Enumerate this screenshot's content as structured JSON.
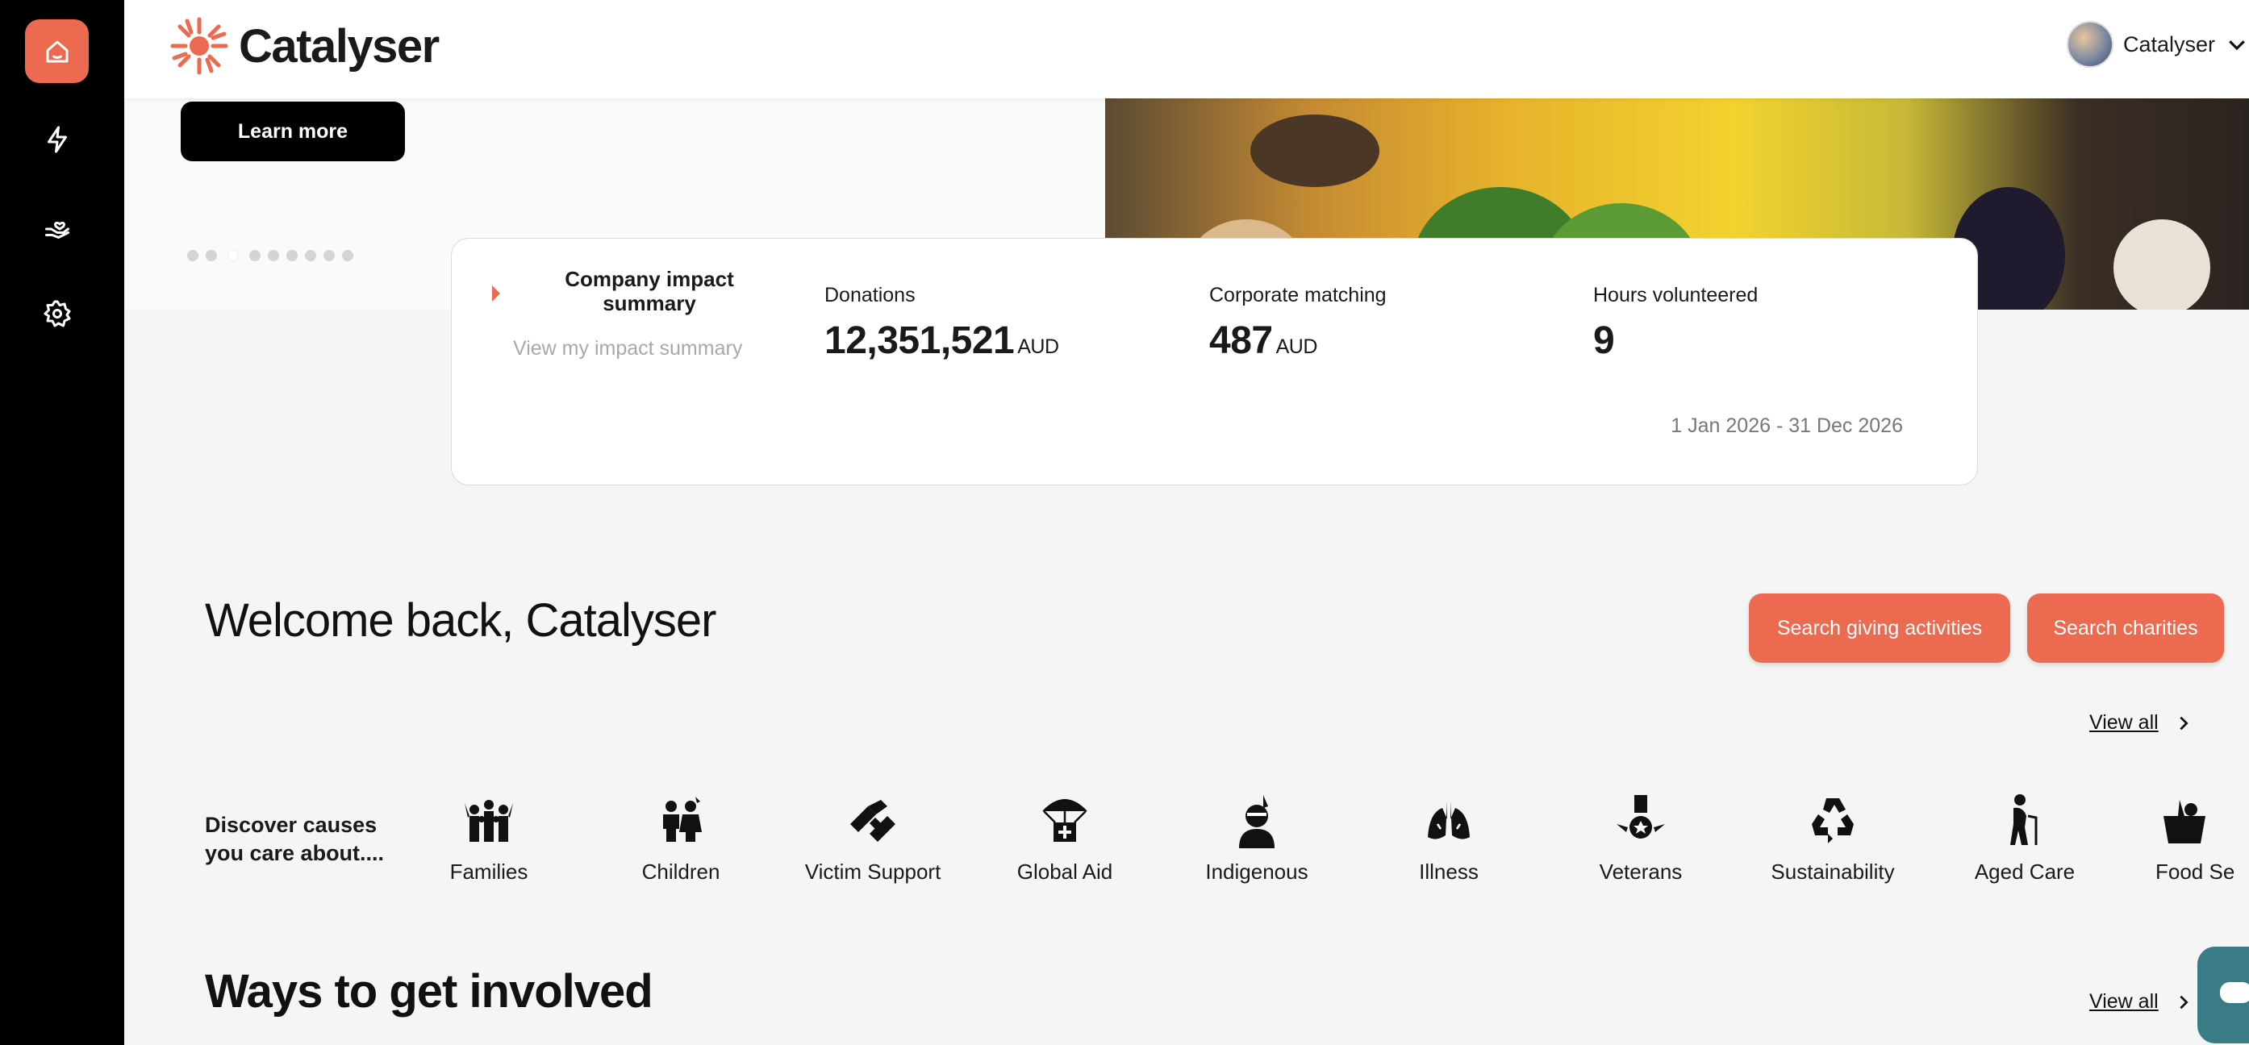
{
  "sidebar": {
    "items": [
      {
        "icon": "home-icon",
        "active": true
      },
      {
        "icon": "lightning-icon",
        "active": false
      },
      {
        "icon": "hand-heart-icon",
        "active": false
      },
      {
        "icon": "gear-icon",
        "active": false
      }
    ]
  },
  "header": {
    "brand": "Catalyser",
    "user_name": "Catalyser"
  },
  "hero": {
    "learn_more": "Learn more"
  },
  "impact": {
    "title": "Company impact summary",
    "link": "View my impact summary",
    "stats": [
      {
        "label": "Donations",
        "value": "12,351,521",
        "unit": "AUD"
      },
      {
        "label": "Corporate matching",
        "value": "487",
        "unit": "AUD"
      },
      {
        "label": "Hours volunteered",
        "value": "9",
        "unit": ""
      }
    ],
    "date_range": "1 Jan 2026 - 31 Dec 2026"
  },
  "welcome": {
    "title": "Welcome back, Catalyser",
    "search_activities": "Search giving activities",
    "search_charities": "Search charities",
    "view_all": "View all"
  },
  "causes": {
    "label": "Discover causes you care about....",
    "items": [
      {
        "label": "Families",
        "icon": "families-icon"
      },
      {
        "label": "Children",
        "icon": "children-icon"
      },
      {
        "label": "Victim Support",
        "icon": "victim-support-icon"
      },
      {
        "label": "Global Aid",
        "icon": "global-aid-icon"
      },
      {
        "label": "Indigenous",
        "icon": "indigenous-icon"
      },
      {
        "label": "Illness",
        "icon": "lungs-icon"
      },
      {
        "label": "Veterans",
        "icon": "medal-icon"
      },
      {
        "label": "Sustainability",
        "icon": "recycle-icon"
      },
      {
        "label": "Aged Care",
        "icon": "aged-care-icon"
      },
      {
        "label": "Food Se",
        "icon": "food-security-icon"
      }
    ]
  },
  "involved": {
    "title": "Ways to get involved",
    "view_all": "View all"
  },
  "colors": {
    "accent": "#ec6a50",
    "sidebar": "#000000",
    "chat": "#3a7c86"
  }
}
